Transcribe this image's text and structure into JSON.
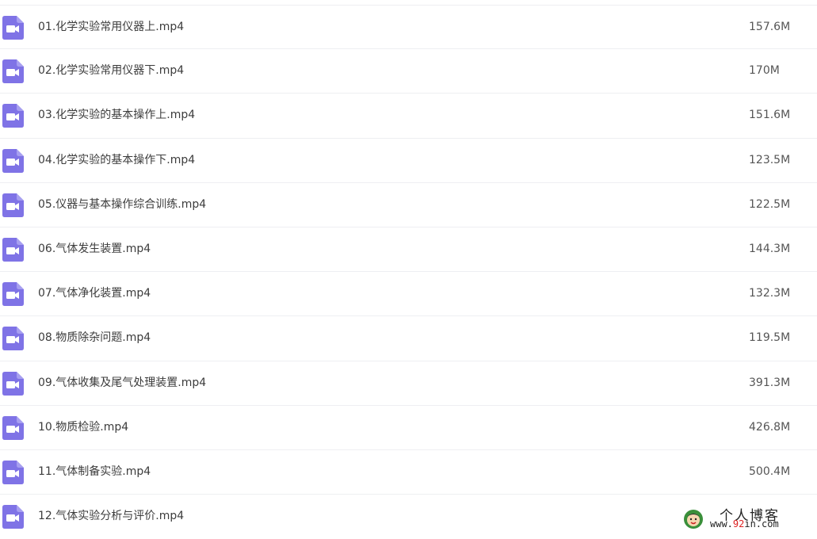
{
  "theme": {
    "icon_color": "#7f73e6",
    "divider_color": "#eeeff2"
  },
  "files": [
    {
      "name": "01.化学实验常用仪器上.mp4",
      "size": "157.6M",
      "icon": "video-file-icon"
    },
    {
      "name": "02.化学实验常用仪器下.mp4",
      "size": "170M",
      "icon": "video-file-icon"
    },
    {
      "name": "03.化学实验的基本操作上.mp4",
      "size": "151.6M",
      "icon": "video-file-icon"
    },
    {
      "name": "04.化学实验的基本操作下.mp4",
      "size": "123.5M",
      "icon": "video-file-icon"
    },
    {
      "name": "05.仪器与基本操作综合训练.mp4",
      "size": "122.5M",
      "icon": "video-file-icon"
    },
    {
      "name": "06.气体发生装置.mp4",
      "size": "144.3M",
      "icon": "video-file-icon"
    },
    {
      "name": "07.气体净化装置.mp4",
      "size": "132.3M",
      "icon": "video-file-icon"
    },
    {
      "name": "08.物质除杂问题.mp4",
      "size": "119.5M",
      "icon": "video-file-icon"
    },
    {
      "name": "09.气体收集及尾气处理装置.mp4",
      "size": "391.3M",
      "icon": "video-file-icon"
    },
    {
      "name": "10.物质检验.mp4",
      "size": "426.8M",
      "icon": "video-file-icon"
    },
    {
      "name": "11.气体制备实验.mp4",
      "size": "500.4M",
      "icon": "video-file-icon"
    },
    {
      "name": "12.气体实验分析与评价.mp4",
      "size": "",
      "icon": "video-file-icon"
    }
  ],
  "watermark": {
    "title": "个人博客",
    "url_prefix": "www.",
    "url_accent": "92",
    "url_suffix": "in.com",
    "icon": "blog-avatar-icon"
  }
}
